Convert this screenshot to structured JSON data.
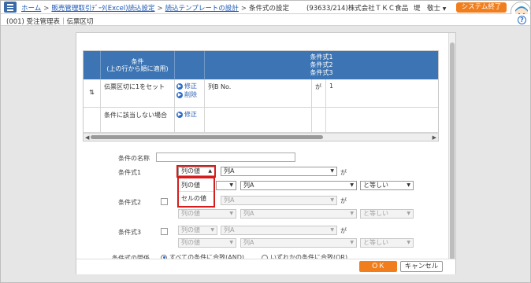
{
  "topbar": {
    "breadcrumbs": [
      "ホーム",
      "販売管理取引ﾃﾞｰﾀ(Excel)読込設定",
      "読込テンプレートの設計"
    ],
    "current": "条件式の設定",
    "company": "(93633/214)株式会社ＴＫＣ食品",
    "user": "堤　敬士",
    "end_button": "システム終了"
  },
  "subbar": {
    "text": "(001) 受注管理表｜伝票区切"
  },
  "table": {
    "header_condition": "条件\n(上の行から順に適用)",
    "header_expr": "条件式1\n条件式2\n条件式3",
    "rows": [
      {
        "sort_icon": "⇅",
        "name": "伝票区切に1をセット",
        "edit": "修正",
        "delete": "削除",
        "column": "列B No.",
        "op": "が",
        "value": "1"
      },
      {
        "name": "条件に該当しない場合",
        "edit": "修正"
      }
    ]
  },
  "form": {
    "name_label": "条件の名称",
    "name_value": "",
    "cond1_label": "条件式1",
    "cond2_label": "条件式2",
    "cond3_label": "条件式3",
    "type_value": "列の値",
    "col_value": "列A",
    "ga": "が",
    "equal": "と等しい",
    "dropdown_options": [
      "列の値",
      "セルの値"
    ],
    "combine_label": "条件式の関係",
    "radio_all": "すべての条件に合致(AND)",
    "radio_any": "いずれかの条件に合致(OR)"
  },
  "buttons": {
    "ok": "ＯＫ",
    "cancel": "キャンセル"
  }
}
